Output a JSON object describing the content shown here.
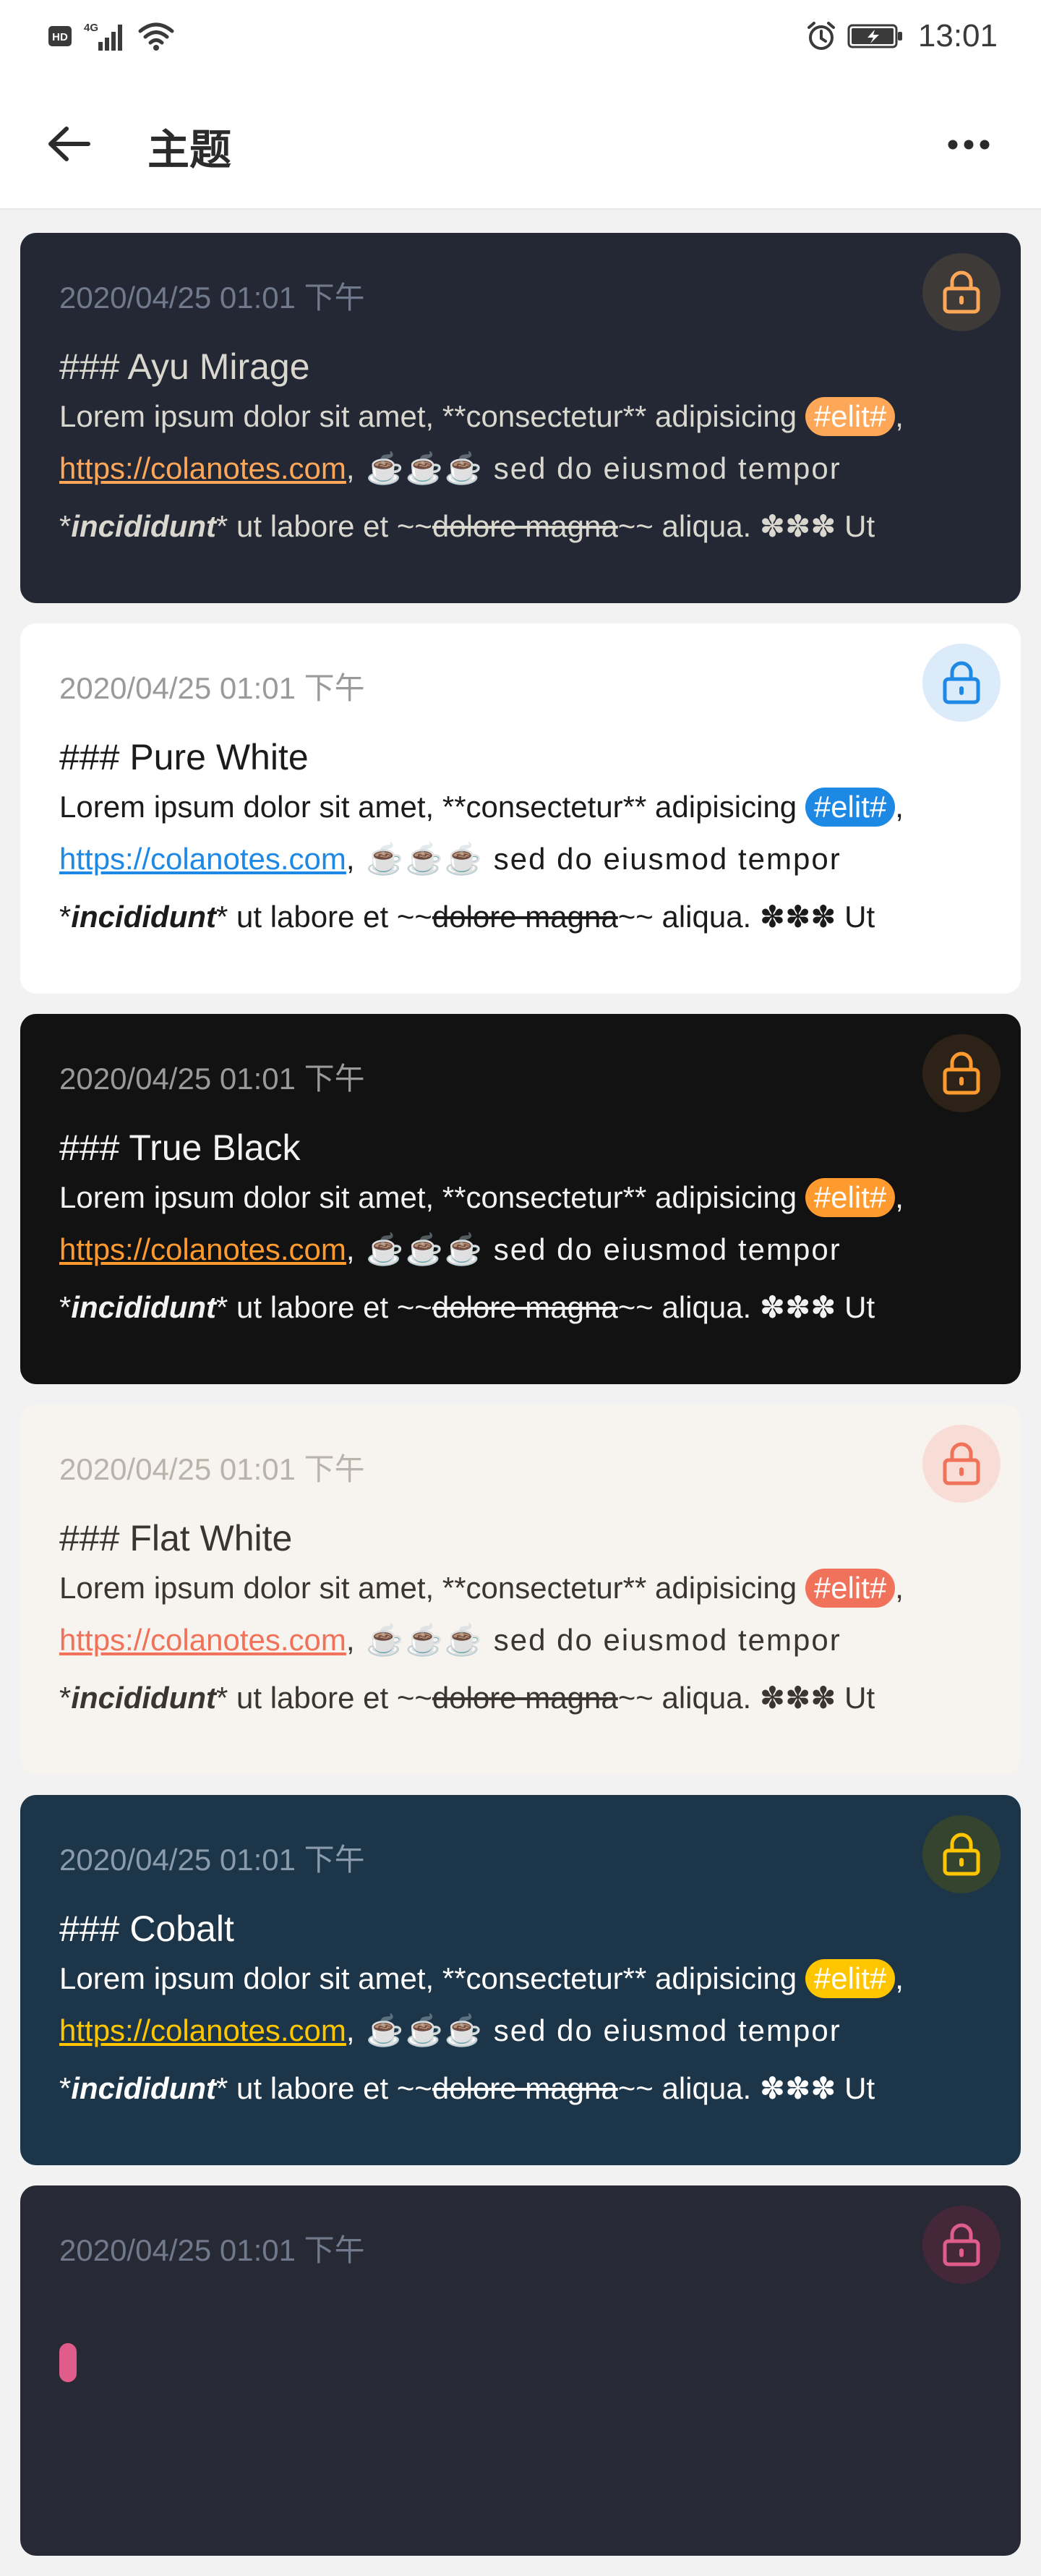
{
  "status_bar": {
    "left_icons": [
      "hd-icon",
      "4g-signal-icon",
      "wifi-icon"
    ],
    "hd_label": "HD",
    "net_label": "4G",
    "time": "13:01"
  },
  "appbar": {
    "title": "主题"
  },
  "themes": [
    {
      "date": "2020/04/25 01:01 下午",
      "heading": "### Ayu Mirage",
      "l1a": "Lorem ipsum dolor sit amet, **consectetur** adipisicing ",
      "tag": "#elit#",
      "l1b": ",",
      "link": "https://colanotes.com",
      "l2b": ", ☕☕☕ sed do eiusmod tempor",
      "l3a": "*",
      "em": "incididunt",
      "l3b": "* ut labore et ~~",
      "strike": "dolore magna",
      "l3c": "~~ aliqua. ✽✽✽ Ut",
      "colors": {
        "bg": "#232834",
        "text": "#d9d7ce",
        "date": "#707a8c",
        "accent": "#ffa759",
        "lock_bg": "#3d3a38"
      }
    },
    {
      "date": "2020/04/25 01:01 下午",
      "heading": "### Pure White",
      "l1a": "Lorem ipsum dolor sit amet, **consectetur** adipisicing ",
      "tag": "#elit#",
      "l1b": ",",
      "link": "https://colanotes.com",
      "l2b": ", ☕☕☕ sed do eiusmod tempor",
      "l3a": "*",
      "em": "incididunt",
      "l3b": "* ut labore et ~~",
      "strike": "dolore magna",
      "l3c": "~~ aliqua. ✽✽✽ Ut",
      "colors": {
        "bg": "#ffffff",
        "text": "#1b1b1b",
        "date": "#9a9a9a",
        "accent": "#1e88e5",
        "lock_bg": "#dcebfa"
      }
    },
    {
      "date": "2020/04/25 01:01 下午",
      "heading": "### True Black",
      "l1a": "Lorem ipsum dolor sit amet, **consectetur** adipisicing ",
      "tag": "#elit#",
      "l1b": ",",
      "link": "https://colanotes.com",
      "l2b": ", ☕☕☕ sed do eiusmod tempor",
      "l3a": "*",
      "em": "incididunt",
      "l3b": "* ut labore et ~~",
      "strike": "dolore magna",
      "l3c": "~~ aliqua. ✽✽✽ Ut",
      "colors": {
        "bg": "#121212",
        "text": "#f2f2f2",
        "date": "#9a9a9a",
        "accent": "#ff9a2e",
        "lock_bg": "#2d2218"
      }
    },
    {
      "date": "2020/04/25 01:01 下午",
      "heading": "### Flat White",
      "l1a": "Lorem ipsum dolor sit amet, **consectetur** adipisicing ",
      "tag": "#elit#",
      "l1b": ",",
      "link": "https://colanotes.com",
      "l2b": ", ☕☕☕ sed do eiusmod tempor",
      "l3a": "*",
      "em": "incididunt",
      "l3b": "* ut labore et ~~",
      "strike": "dolore magna",
      "l3c": "~~ aliqua. ✽✽✽ Ut",
      "colors": {
        "bg": "#f7f3ee",
        "text": "#3a3530",
        "date": "#b9b3ab",
        "accent": "#f0725a",
        "lock_bg": "#f8ddd7"
      }
    },
    {
      "date": "2020/04/25 01:01 下午",
      "heading": "### Cobalt",
      "l1a": "Lorem ipsum dolor sit amet, **consectetur** adipisicing ",
      "tag": "#elit#",
      "l1b": ",",
      "link": "https://colanotes.com",
      "l2b": ", ☕☕☕ sed do eiusmod tempor",
      "l3a": "*",
      "em": "incididunt",
      "l3b": "* ut labore et ~~",
      "strike": "dolore magna",
      "l3c": "~~ aliqua. ✽✽✽ Ut",
      "colors": {
        "bg": "#1c3548",
        "text": "#ffffff",
        "date": "#8a9bab",
        "accent": "#ffc600",
        "lock_bg": "#34442e"
      }
    },
    {
      "date": "2020/04/25 01:01 下午",
      "heading": "",
      "l1a": "",
      "tag": "",
      "l1b": "",
      "link": "",
      "l2b": "",
      "l3a": "",
      "em": "",
      "l3b": "",
      "strike": "",
      "l3c": "",
      "colors": {
        "bg": "#272935",
        "text": "#d9d7ce",
        "date": "#707a8c",
        "accent": "#e05c8a",
        "lock_bg": "#44283a"
      }
    }
  ]
}
